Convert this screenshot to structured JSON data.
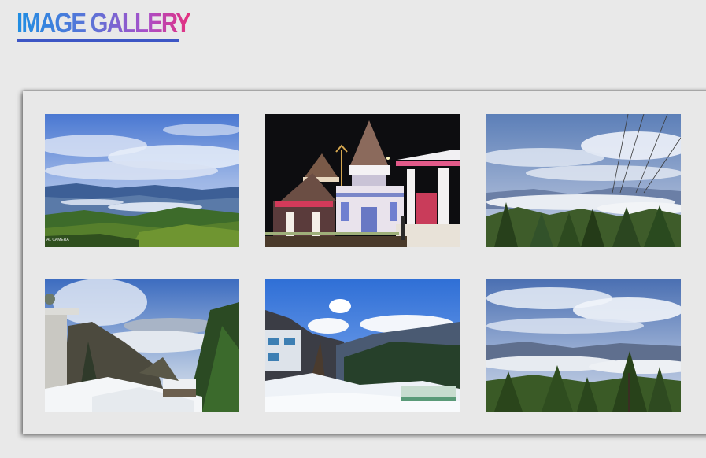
{
  "header": {
    "title": "IMAGE GALLERY"
  },
  "gallery": {
    "photos": [
      {
        "subject": "mountain valley under blue sky with clouds",
        "icon": "landscape-photo",
        "watermark": "AL CAMERA"
      },
      {
        "subject": "illuminated temple at night",
        "icon": "temple-photo"
      },
      {
        "subject": "clouds over forested hills with power lines",
        "icon": "landscape-photo"
      },
      {
        "subject": "snow covered hillside with trees",
        "icon": "snow-photo"
      },
      {
        "subject": "snowy village with mountains and blue sky",
        "icon": "snow-photo"
      },
      {
        "subject": "pine trees with sea of clouds and mountains",
        "icon": "landscape-photo"
      }
    ]
  },
  "colors": {
    "background": "#e9e9e9",
    "title_gradient_start": "#1f8ee3",
    "title_gradient_end": "#e5307e",
    "underline": "#3d56c5"
  }
}
